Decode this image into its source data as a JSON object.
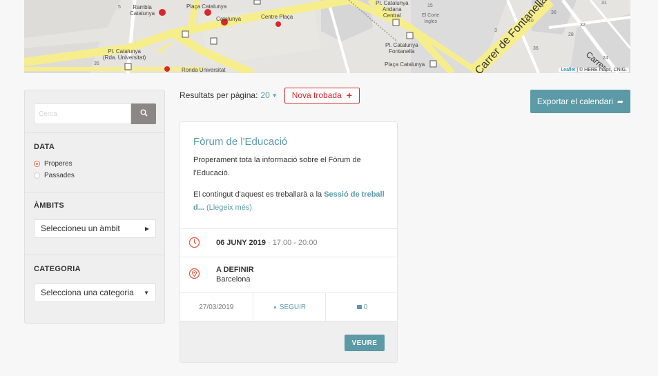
{
  "map": {
    "labels": [
      {
        "text": "5"
      },
      {
        "text": "Rambla\nCatalunya"
      },
      {
        "text": "Plaça Catalunya"
      },
      {
        "text": "Catalunya"
      },
      {
        "text": "Centre Plaça"
      },
      {
        "text": "Pl. Catalunya\n(Rda. Universitat)"
      },
      {
        "text": "Ronda Universitat"
      },
      {
        "text": "Pl. Catalunya\nAndana\nCentral"
      },
      {
        "text": "El Corte\nIngles"
      },
      {
        "text": "Pl. Catalunya\nFontanella"
      },
      {
        "text": "Plaça Catalunya"
      },
      {
        "text": "35"
      },
      {
        "text": "15"
      },
      {
        "text": "3"
      },
      {
        "text": "10"
      },
      {
        "text": "12"
      },
      {
        "text": "36"
      },
      {
        "text": "32"
      },
      {
        "text": "28"
      },
      {
        "text": "36"
      },
      {
        "text": "24"
      },
      {
        "text": "31"
      }
    ],
    "road_label_1": "Carrer de Fontanella",
    "road_label_2": "Carrer",
    "attribution_leaflet": "Leaflet",
    "attribution_rest": " | © HERE maps, CNIG."
  },
  "sidebar": {
    "search_placeholder": "Cerca",
    "data_title": "DATA",
    "radio_upcoming": "Properes",
    "radio_past": "Passades",
    "ambits_title": "ÀMBITS",
    "ambits_select": "Seleccioneu un àmbit",
    "categoria_title": "CATEGORIA",
    "categoria_select": "Selecciona una categoria"
  },
  "toolbar": {
    "per_page_label": "Resultats per pàgina:",
    "per_page_value": "20",
    "new_button": "Nova trobada",
    "export_button": "Exportar el calendari"
  },
  "card": {
    "title": "Fòrum de l'Educació",
    "desc": "Properament tota la informació sobre el Fòrum de l'Educació.",
    "desc2_prefix": "El contingut d'aquest es treballarà a la ",
    "desc2_link": "Sessió de treball d...",
    "desc2_more": " (Llegeix més)",
    "date": "06 JUNY 2019",
    "time_sep": " · ",
    "time": "17:00 - 20:00",
    "location_name": "A DEFINIR",
    "location_city": "Barcelona",
    "created": "27/03/2019",
    "follow": "SEGUIR",
    "comments": "0",
    "view_button": "VEURE"
  },
  "colors": {
    "accent": "#5b9aa6",
    "danger": "#d9262c",
    "radio_on": "#e07555"
  }
}
